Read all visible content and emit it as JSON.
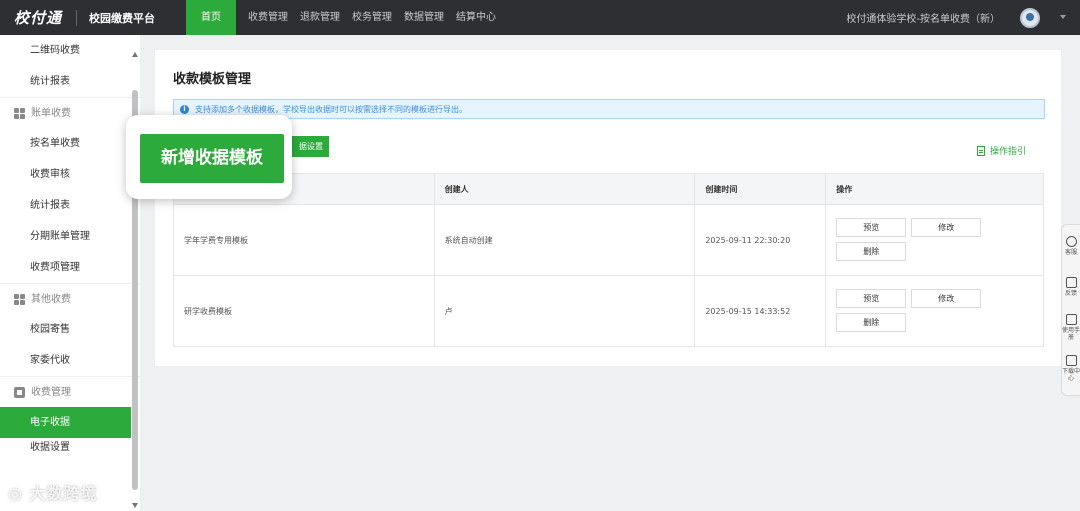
{
  "header": {
    "logo": "校付通",
    "platform": "校园缴费平台",
    "nav": [
      "首页",
      "收费管理",
      "退款管理",
      "校务管理",
      "数据管理",
      "结算中心"
    ],
    "school": "校付通体验学校-按名单收费（新）"
  },
  "sidebar": {
    "items_top": [
      "二维码收费",
      "统计报表"
    ],
    "group1": {
      "title": "账单收费",
      "items": [
        "按名单收费",
        "收费审核",
        "统计报表",
        "分期账单管理",
        "收费项管理"
      ]
    },
    "group2": {
      "title": "其他收费",
      "items": [
        "校园寄售",
        "家委代收"
      ]
    },
    "group3": {
      "title": "收费管理",
      "items": [
        "电子收据",
        "收据设置"
      ]
    }
  },
  "main": {
    "title": "收款模板管理",
    "tip": "支持添加多个收据模板，学校导出收据时可以按需选择不同的模板进行导出。",
    "receipt_settings_button": "据设置",
    "guide": "操作指引",
    "add_template_button": "新增收据模板",
    "table": {
      "headers": [
        "",
        "创建人",
        "创建时间",
        "操作"
      ],
      "rows": [
        {
          "name": "学年学费专用模板",
          "creator": "系统自动创建",
          "time": "2025-09-11 22:30:20"
        },
        {
          "name": "研学收费模板",
          "creator": "卢",
          "time": "2025-09-15 14:33:52"
        }
      ],
      "op_preview": "预览",
      "op_edit": "修改",
      "op_delete": "删除"
    }
  },
  "float_tools": [
    "客服",
    "反馈",
    "使用手册",
    "下载中心"
  ],
  "watermark": "◎ 大数跨境",
  "colors": {
    "accent": "#2daa3c",
    "topbar": "#2d2f33",
    "tip_text": "#3a8ee0"
  }
}
